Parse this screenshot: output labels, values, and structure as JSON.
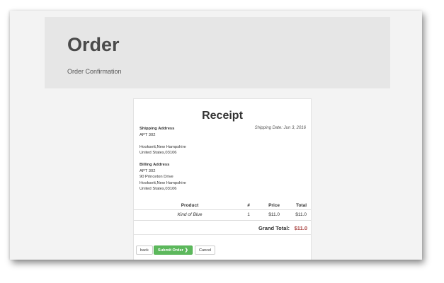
{
  "header": {
    "title": "Order",
    "subtitle": "Order Confirmation"
  },
  "receipt": {
    "title": "Receipt",
    "shipping_date": "Shipping Date: Jun 3, 2016",
    "shipping": {
      "label": "Shipping Address",
      "lines": [
        "APT 302",
        "",
        "Hooksett,New Hampshire",
        "United States,03106"
      ]
    },
    "billing": {
      "label": "Billing Address",
      "lines": [
        "APT 302",
        "90 Princeton Drive",
        "Hooksett,New Hampshire",
        "United States,03106"
      ]
    },
    "table": {
      "headers": {
        "product": "Product",
        "qty": "#",
        "price": "Price",
        "total": "Total"
      },
      "rows": [
        {
          "product": "Kind of Blue",
          "qty": "1",
          "price": "$11.0",
          "total": "$11.0"
        }
      ],
      "grand_total_label": "Grand Total:",
      "grand_total_value": "$11.0"
    }
  },
  "actions": {
    "back_label": "back",
    "submit_label": "Submit Order",
    "submit_icon": "chevron-right-icon",
    "cancel_label": "Cancel"
  },
  "colors": {
    "success": "#5cb85c",
    "grand_total": "#a94442",
    "page_bg": "#f3f3f3",
    "jumbotron_bg": "#e6e6e6"
  }
}
